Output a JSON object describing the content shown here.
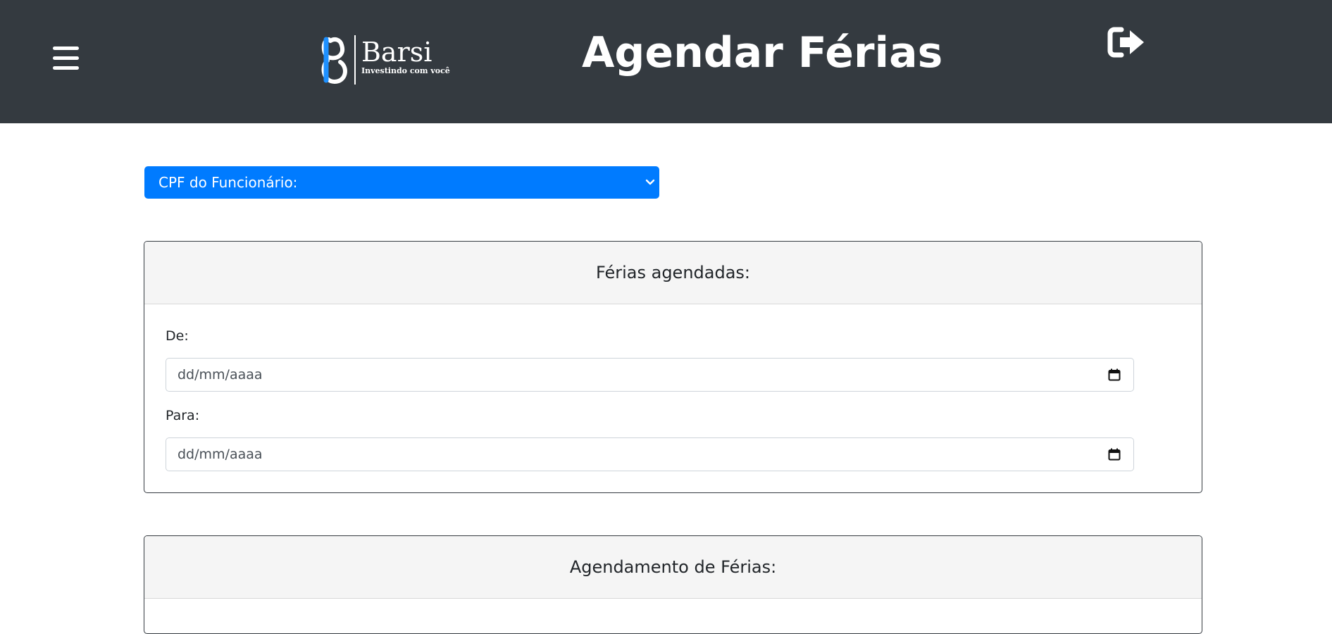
{
  "header": {
    "title": "Agendar Férias",
    "logo": {
      "name": "Barsi",
      "tagline": "Investindo com você"
    },
    "background": "#343a40"
  },
  "icons": {
    "menu": "hamburger-menu-icon",
    "logout": "sign-out-icon",
    "select": "chevron-down-icon",
    "date": "calendar-icon"
  },
  "employee_select": {
    "selected": "CPF do Funcionário:",
    "color": "#007bff"
  },
  "scheduled_card": {
    "title": "Férias agendadas:",
    "from_label": "De:",
    "from_placeholder": "dd/mm/aaaa",
    "to_label": "Para:",
    "to_placeholder": "dd/mm/aaaa"
  },
  "scheduling_card": {
    "title": "Agendamento de Férias:"
  }
}
